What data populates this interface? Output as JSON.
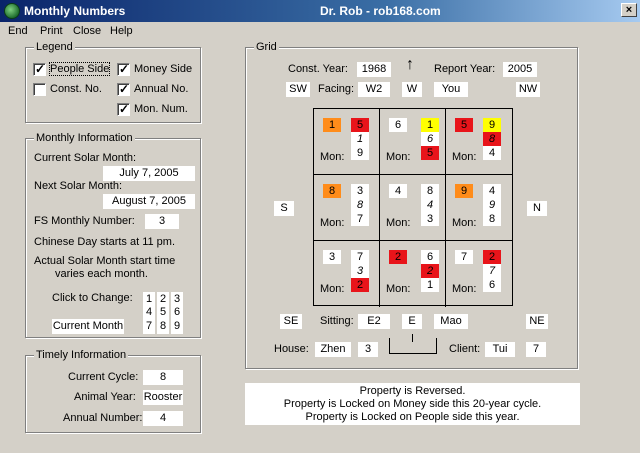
{
  "window": {
    "title": "Monthly Numbers",
    "center_title": "Dr. Rob - rob168.com",
    "close": "×"
  },
  "menu": [
    "End",
    "Print",
    "Close",
    "Help"
  ],
  "legend": {
    "title": "Legend",
    "people_side": "People Side",
    "money_side": "Money Side",
    "const_no": "Const. No.",
    "annual_no": "Annual No.",
    "mon_num": "Mon. Num.",
    "checked_mark": "✓"
  },
  "monthly": {
    "title": "Monthly Information",
    "current_label": "Current Solar Month:",
    "current_value": "July 7, 2005",
    "next_label": "Next Solar Month:",
    "next_value": "August 7, 2005",
    "fs_label": "FS Monthly Number:",
    "fs_value": "3",
    "chinese_day": "Chinese Day starts at 11 pm.",
    "actual_1": "Actual Solar Month start time",
    "actual_2": "varies each month.",
    "click_label": "Click to Change:",
    "current_month": "Current Month",
    "buttons": [
      "1",
      "2",
      "3",
      "4",
      "5",
      "6",
      "7",
      "8",
      "9"
    ]
  },
  "timely": {
    "title": "Timely Information",
    "cycle_label": "Current Cycle:",
    "cycle_value": "8",
    "animal_label": "Animal Year:",
    "animal_value": "Rooster",
    "annual_label": "Annual Number:",
    "annual_value": "4"
  },
  "grid": {
    "title": "Grid",
    "const_year_label": "Const. Year:",
    "const_year": "1968",
    "report_year_label": "Report Year:",
    "report_year": "2005",
    "sw": "SW",
    "facing_label": "Facing:",
    "facing_1": "W2",
    "facing_2": "W",
    "facing_3": "You",
    "nw": "NW",
    "s": "S",
    "n": "N",
    "se": "SE",
    "sitting_label": "Sitting:",
    "sitting_1": "E2",
    "sitting_2": "E",
    "sitting_3": "Mao",
    "ne": "NE",
    "house_label": "House:",
    "house_1": "Zhen",
    "house_2": "3",
    "client_label": "Client:",
    "client_1": "Tui",
    "client_2": "7",
    "mon_label": "Mon:",
    "cells": [
      {
        "a": "1",
        "b": "5",
        "c": "1",
        "d": "9"
      },
      {
        "a": "6",
        "b": "1",
        "c": "6",
        "d": "5"
      },
      {
        "a": "5",
        "b": "9",
        "c": "8",
        "d": "4"
      },
      {
        "a": "8",
        "b": "3",
        "c": "8",
        "d": "7"
      },
      {
        "a": "4",
        "b": "8",
        "c": "4",
        "d": "3"
      },
      {
        "a": "9",
        "b": "4",
        "c": "9",
        "d": "8"
      },
      {
        "a": "3",
        "b": "7",
        "c": "3",
        "d": "2"
      },
      {
        "a": "2",
        "b": "6",
        "c": "2",
        "d": "1"
      },
      {
        "a": "7",
        "b": "2",
        "c": "7",
        "d": "6"
      }
    ]
  },
  "colors": {
    "orange": "#ff8c1a",
    "red": "#e8141a",
    "yellow": "#ffff00"
  },
  "messages": [
    "Property is Reversed.",
    "Property is Locked on Money side this 20-year cycle.",
    "Property is Locked on People side this year."
  ]
}
